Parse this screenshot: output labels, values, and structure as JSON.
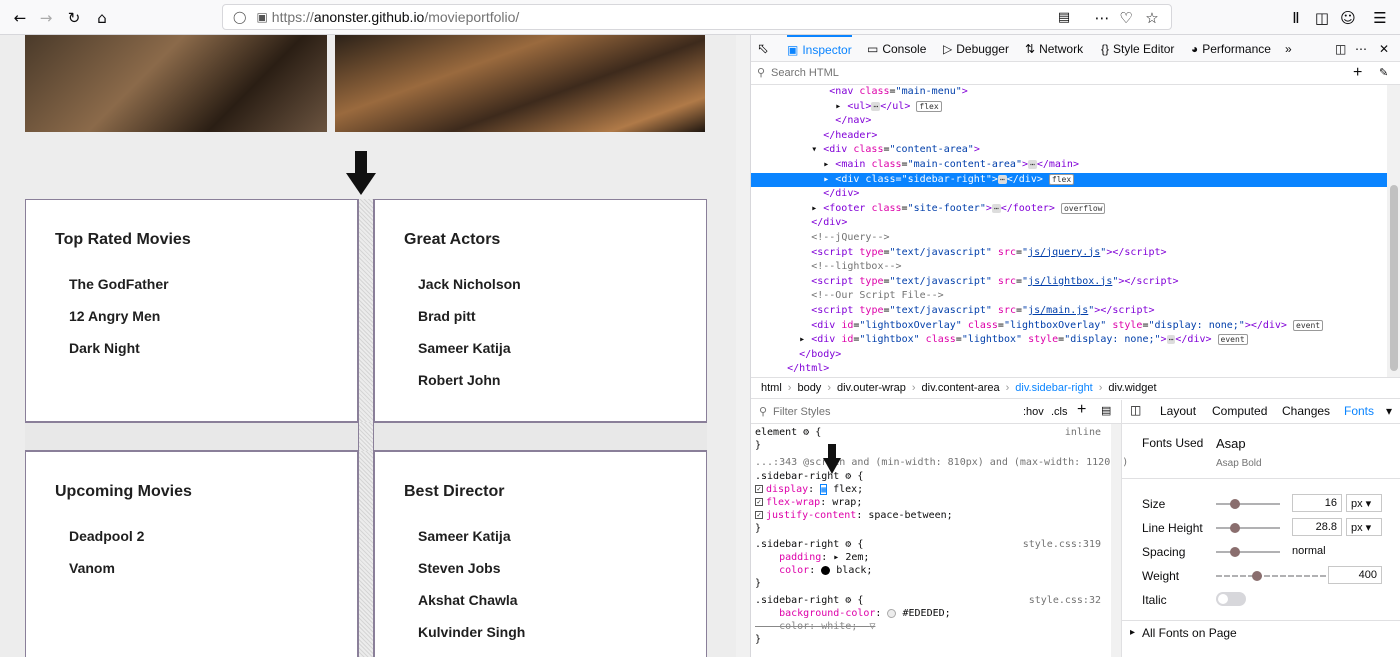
{
  "browser": {
    "url_prefix": "https://",
    "url_host": "anonster.github.io",
    "url_path": "/movieportfolio/"
  },
  "page": {
    "boxes": [
      {
        "title": "Top Rated Movies",
        "items": [
          "The GodFather",
          "12 Angry Men",
          "Dark Night"
        ]
      },
      {
        "title": "Great Actors",
        "items": [
          "Jack Nicholson",
          "Brad pitt",
          "Sameer Katija",
          "Robert John"
        ]
      },
      {
        "title": "Upcoming Movies",
        "items": [
          "Deadpool 2",
          "Vanom"
        ]
      },
      {
        "title": "Best Director",
        "items": [
          "Sameer Katija",
          "Steven Jobs",
          "Akshat Chawla",
          "Kulvinder Singh"
        ]
      }
    ]
  },
  "devtools": {
    "tabs": [
      "Inspector",
      "Console",
      "Debugger",
      "Network",
      "Style Editor",
      "Performance"
    ],
    "search_placeholder": "Search HTML",
    "breadcrumbs": [
      "html",
      "body",
      "div.outer-wrap",
      "div.content-area",
      "div.sidebar-right",
      "div.widget"
    ],
    "filter_placeholder": "Filter Styles",
    "hov": ":hov",
    "cls": ".cls",
    "side_tabs": [
      "Layout",
      "Computed",
      "Changes",
      "Fonts"
    ],
    "fonts": {
      "used_label": "Fonts Used",
      "font_name": "Asap",
      "font_variant": "Asap Bold",
      "size_label": "Size",
      "size_value": "16",
      "size_unit": "px",
      "line_height_label": "Line Height",
      "line_height_value": "28.8",
      "line_height_unit": "px",
      "spacing_label": "Spacing",
      "spacing_value": "normal",
      "weight_label": "Weight",
      "weight_value": "400",
      "italic_label": "Italic",
      "all_fonts": "All Fonts on Page"
    },
    "accent": "#0a84ff"
  }
}
